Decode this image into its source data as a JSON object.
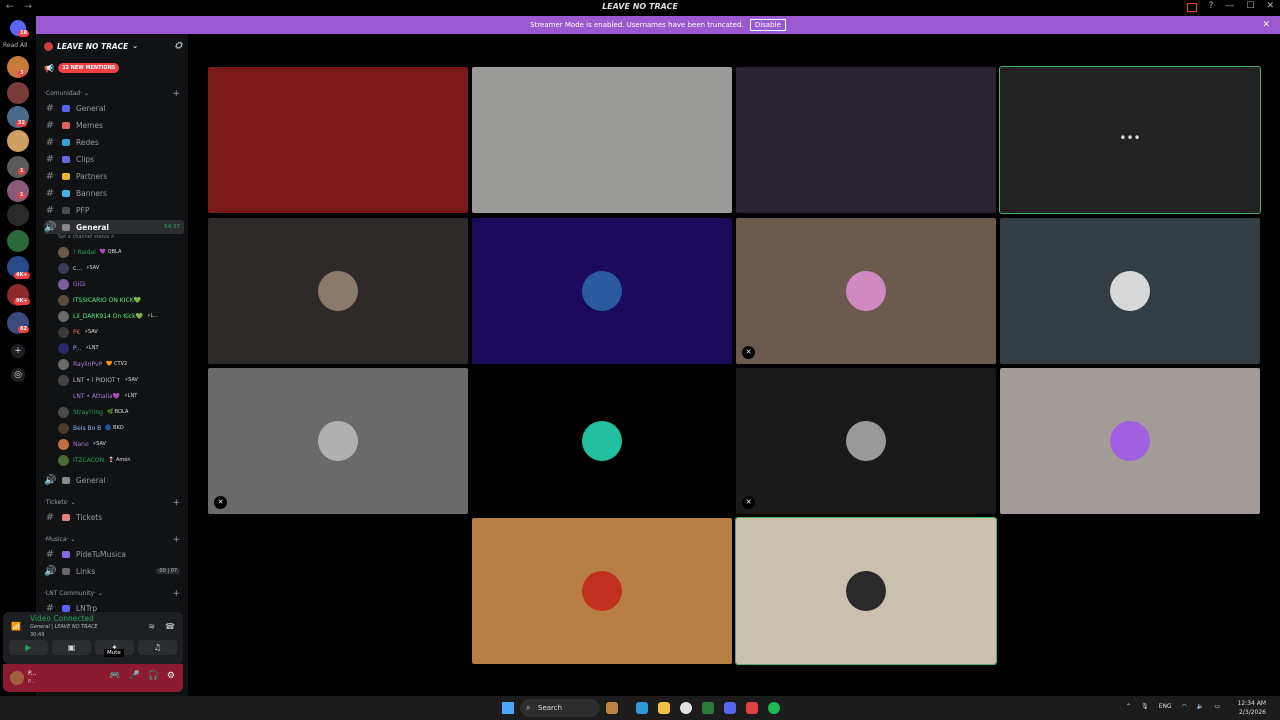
{
  "window": {
    "title": "LEAVE NO TRACE",
    "nav": "← →"
  },
  "rail": {
    "read_all": "Read All",
    "badges": [
      "18",
      "3",
      "32",
      "1",
      "1",
      "4K+",
      "9K+",
      "82",
      "1",
      "1",
      "3"
    ]
  },
  "banner": {
    "text": "Streamer Mode is enabled. Usernames have been truncated.",
    "disable_label": "Disable"
  },
  "guild": {
    "name": "LEAVE NO TRACE",
    "mentions_label": "32 NEW MENTIONS"
  },
  "categories": {
    "comunidad": "·Comunidad· ⌄",
    "tickets": "·Tickets· ⌄",
    "musica": "·Musica· ⌄",
    "lnt_community": "·LNT Community· ⌄"
  },
  "channels": {
    "general": "General",
    "memes": "Memes",
    "redes": "Redes",
    "clips": "Clips",
    "partners": "Partners",
    "banners": "Banners",
    "pfp": "PFP",
    "voice_general": "General",
    "voice_timer": "54:37",
    "status_prompt": "Set a channel status ✐",
    "voice_general2": "General",
    "tickets": "Tickets",
    "pidetumusica": "PideTuMusica",
    "links": "Links",
    "links_pill": "00 | 07",
    "lntrp": "LNTrp"
  },
  "members": [
    {
      "name": "! Raidal",
      "tag": "💜 QBLA",
      "color": "#23a55a",
      "avatar": "#6b5a4a"
    },
    {
      "name": "c...",
      "tag": "⚡SAV",
      "color": "#dbdee1",
      "avatar": "#3a3a5a"
    },
    {
      "name": "GiGi",
      "tag": "",
      "color": "#a77be0",
      "avatar": "#7a5f9a"
    },
    {
      "name": "ITSSICARIO ON KICK💚",
      "tag": "",
      "color": "#57f287",
      "avatar": "#5a4a3a"
    },
    {
      "name": "Lil_DARK914 On Kick💚",
      "tag": "⚡L...",
      "color": "#57f287",
      "avatar": "#6a6a6a"
    },
    {
      "name": "P€",
      "tag": "⚡SAV",
      "color": "#e06060",
      "avatar": "#3a3a3a"
    },
    {
      "name": "P...",
      "tag": "⚡LNT",
      "color": "#8ab4f8",
      "avatar": "#2a2a6a"
    },
    {
      "name": "RaylinPvP",
      "tag": "🧡 CTV2",
      "color": "#a77be0",
      "avatar": "#6a6a6a"
    },
    {
      "name": "LNT • l PIDIOT↑",
      "tag": "⚡SAV",
      "color": "#b5bac1",
      "avatar": "#444"
    },
    {
      "name": "LNT • Athalia💜",
      "tag": "⚡LNT",
      "color": "#a77be0",
      "avatar": "#111214"
    },
    {
      "name": "Stray!!ing",
      "tag": "🌿 BOLA",
      "color": "#23a55a",
      "avatar": "#4a4a4a"
    },
    {
      "name": "Beis Bo B",
      "tag": "🌀 BKD",
      "color": "#8ab4f8",
      "avatar": "#4a3a2a"
    },
    {
      "name": "Nano",
      "tag": "⚡SAV",
      "color": "#a77be0",
      "avatar": "#c07040"
    },
    {
      "name": "ITZCACON",
      "tag": "🍷 Amén",
      "color": "#23a55a",
      "avatar": "#4a6a3a"
    }
  ],
  "voice_panel": {
    "status": "Video Connected",
    "channel": "General | LEAVE NO TRACE",
    "elapsed": "30:49",
    "mute_tooltip": "Mute"
  },
  "user_panel": {
    "name": "P...",
    "status": "P..."
  },
  "tiles": [
    {
      "bg": "#7a1a18",
      "avatar": "",
      "speaking": false,
      "mic_off": false,
      "dots": false
    },
    {
      "bg": "#9a9a98",
      "avatar": "",
      "speaking": false,
      "mic_off": false,
      "dots": false
    },
    {
      "bg": "#2a2430",
      "avatar": "",
      "speaking": false,
      "mic_off": false,
      "dots": false
    },
    {
      "bg": "#232323",
      "avatar": "",
      "speaking": true,
      "mic_off": false,
      "dots": true
    },
    {
      "bg": "#2f2a2a",
      "avatar": "#8a7a6a",
      "speaking": false,
      "mic_off": false,
      "dots": false
    },
    {
      "bg": "#1c0a5a",
      "avatar": "#2a5aa0",
      "speaking": false,
      "mic_off": false,
      "dots": false
    },
    {
      "bg": "#6b5a4d",
      "avatar": "#d08ac0",
      "speaking": false,
      "mic_off": true,
      "dots": false
    },
    {
      "bg": "#333d44",
      "avatar": "#d8d8d8",
      "speaking": false,
      "mic_off": false,
      "dots": false
    },
    {
      "bg": "#6a6a6a",
      "avatar": "#b0b0b0",
      "speaking": false,
      "mic_off": true,
      "dots": false
    },
    {
      "bg": "#000000",
      "avatar": "#20c0a0",
      "speaking": false,
      "mic_off": false,
      "dots": false
    },
    {
      "bg": "#1a1a1a",
      "avatar": "#9a9a9a",
      "speaking": false,
      "mic_off": true,
      "dots": false
    },
    {
      "bg": "#a39b97",
      "avatar": "#a060e0",
      "speaking": false,
      "mic_off": false,
      "dots": false
    },
    {
      "bg": "#b87f44",
      "avatar": "#c03020",
      "speaking": false,
      "mic_off": false,
      "dots": false
    },
    {
      "bg": "#c9c1ad",
      "avatar": "#2a2a2a",
      "speaking": true,
      "mic_off": false,
      "dots": false
    }
  ],
  "taskbar": {
    "search_label": "Search",
    "lang": "ENG",
    "time": "12:34 AM",
    "date": "2/3/2026"
  },
  "colors": {
    "banner": "#9b59d0",
    "speaking_outline": "#4caf6a",
    "user_panel": "#8c1a30"
  }
}
